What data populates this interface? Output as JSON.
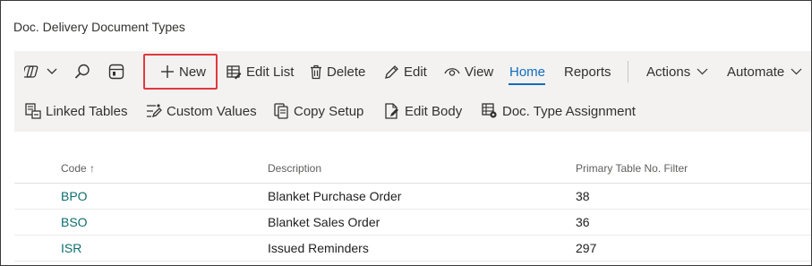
{
  "page": {
    "title": "Doc. Delivery Document Types"
  },
  "toolbar": {
    "new_label": "New",
    "edit_list_label": "Edit List",
    "delete_label": "Delete",
    "edit_label": "Edit",
    "view_label": "View",
    "home_label": "Home",
    "reports_label": "Reports",
    "actions_label": "Actions",
    "automate_label": "Automate"
  },
  "home_actions": {
    "linked_tables": "Linked Tables",
    "custom_values": "Custom Values",
    "copy_setup": "Copy Setup",
    "edit_body": "Edit Body",
    "doc_type_assignment": "Doc. Type Assignment"
  },
  "table": {
    "columns": [
      "Code",
      "Description",
      "Primary Table No. Filter"
    ],
    "sort_indicator": "↑",
    "rows": [
      {
        "code": "BPO",
        "description": "Blanket Purchase Order",
        "filter": "38"
      },
      {
        "code": "BSO",
        "description": "Blanket Sales Order",
        "filter": "36"
      },
      {
        "code": "ISR",
        "description": "Issued Reminders",
        "filter": "297"
      }
    ]
  },
  "colors": {
    "accent": "#0f6cbd",
    "link": "#0f6e6e",
    "highlight": "#e0393e",
    "bar": "#f3f2f1"
  }
}
